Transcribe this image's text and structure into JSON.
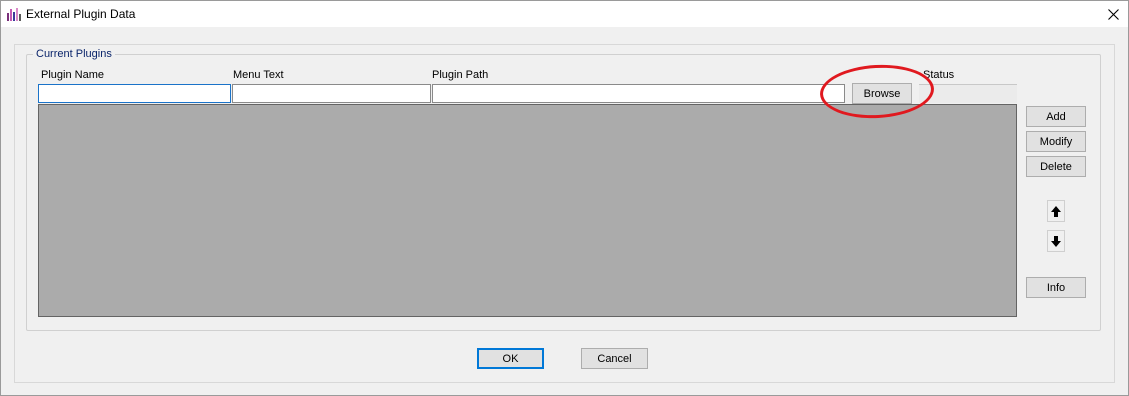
{
  "window": {
    "title": "External Plugin Data",
    "icon": "app-chart-icon",
    "close_icon": "close-icon"
  },
  "group": {
    "title": "Current Plugins"
  },
  "columns": {
    "plugin_name": "Plugin Name",
    "menu_text": "Menu Text",
    "plugin_path": "Plugin Path",
    "status": "Status"
  },
  "fields": {
    "plugin_name_value": "",
    "menu_text_value": "",
    "plugin_path_value": ""
  },
  "buttons": {
    "browse": "Browse",
    "add": "Add",
    "modify": "Modify",
    "delete": "Delete",
    "info": "Info",
    "ok": "OK",
    "cancel": "Cancel",
    "move_up_icon": "arrow-up-icon",
    "move_down_icon": "arrow-down-icon"
  },
  "annotation": {
    "highlight_color": "#e0191f"
  },
  "colors": {
    "grid_background": "#ababab",
    "group_title": "#0a246a",
    "default_button_border": "#0078d7"
  }
}
